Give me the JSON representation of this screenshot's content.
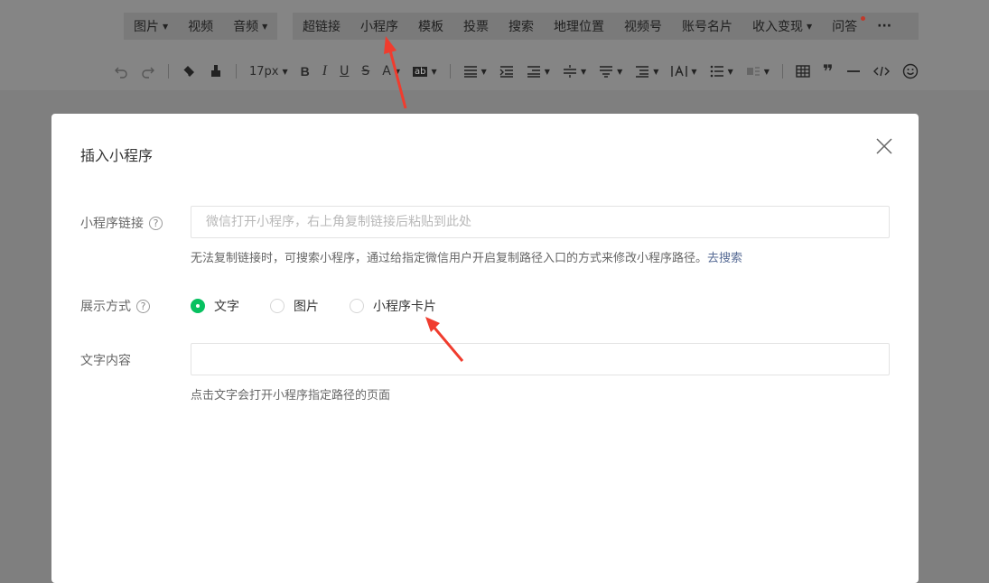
{
  "menu": {
    "group1": [
      {
        "label": "图片",
        "dropdown": true
      },
      {
        "label": "视频",
        "dropdown": false
      },
      {
        "label": "音频",
        "dropdown": true
      }
    ],
    "group2": [
      {
        "label": "超链接",
        "dropdown": false
      },
      {
        "label": "小程序",
        "dropdown": false
      },
      {
        "label": "模板",
        "dropdown": false
      },
      {
        "label": "投票",
        "dropdown": false
      },
      {
        "label": "搜索",
        "dropdown": false
      },
      {
        "label": "地理位置",
        "dropdown": false
      },
      {
        "label": "视频号",
        "dropdown": false
      },
      {
        "label": "账号名片",
        "dropdown": false
      },
      {
        "label": "收入变现",
        "dropdown": true
      },
      {
        "label": "问答",
        "dropdown": false,
        "badge": true
      },
      {
        "label": "···",
        "dropdown": false
      }
    ]
  },
  "format": {
    "font_size": "17px"
  },
  "modal": {
    "title": "插入小程序",
    "link_label": "小程序链接",
    "link_placeholder": "微信打开小程序，右上角复制链接后粘贴到此处",
    "link_value": "",
    "link_hint": "无法复制链接时，可搜索小程序，通过给指定微信用户开启复制路径入口的方式来修改小程序路径。",
    "link_hint_action": "去搜索",
    "display_label": "展示方式",
    "display_options": [
      {
        "label": "文字",
        "checked": true
      },
      {
        "label": "图片",
        "checked": false
      },
      {
        "label": "小程序卡片",
        "checked": false
      }
    ],
    "text_label": "文字内容",
    "text_value": "",
    "text_hint": "点击文字会打开小程序指定路径的页面"
  },
  "colors": {
    "accent": "#07c160",
    "link": "#576b95",
    "annotation_arrow": "#f03c2e"
  }
}
